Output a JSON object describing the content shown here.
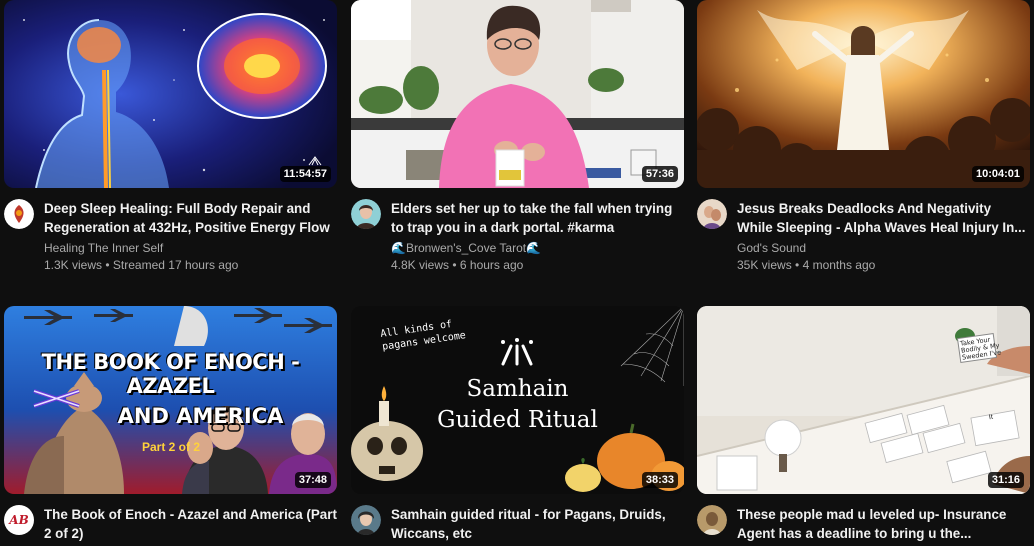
{
  "videos": [
    {
      "title": "Deep Sleep Healing: Full Body Repair and Regeneration at 432Hz, Positive Energy Flow",
      "channel": "Healing The Inner Self",
      "views": "1.3K views",
      "age": "Streamed 17 hours ago",
      "duration": "11:54:57"
    },
    {
      "title": "Elders set her up to take the fall when trying to trap you in a dark portal. #karma",
      "channel": "🌊Bronwen's_Cove Tarot🌊",
      "views": "4.8K views",
      "age": "6 hours ago",
      "duration": "57:36"
    },
    {
      "title": "Jesus Breaks Deadlocks And Negativity While Sleeping - Alpha Waves Heal Injury In...",
      "channel": "God's Sound",
      "views": "35K views",
      "age": "4 months ago",
      "duration": "10:04:01"
    },
    {
      "title": "The Book of Enoch - Azazel and America (Part 2 of 2)",
      "duration": "37:48",
      "thumb_text": {
        "line1": "THE BOOK OF ENOCH - AZAZEL",
        "line2": "AND AMERICA",
        "part": "Part 2 of 2"
      },
      "avatar_text": "AB"
    },
    {
      "title": "Samhain guided ritual - for Pagans, Druids, Wiccans, etc",
      "duration": "38:33",
      "thumb_text": {
        "note1": "All kinds of",
        "note2": "pagans welcome",
        "title1": "Samhain",
        "title2": "Guided Ritual"
      }
    },
    {
      "title": "These people mad u leveled up- Insurance Agent has a deadline to bring u the...",
      "duration": "31:16",
      "thumb_text": {
        "card1": "Take Your",
        "card2": "Bodily & My",
        "card3": "Sweden I've",
        "card4": "It"
      }
    }
  ]
}
